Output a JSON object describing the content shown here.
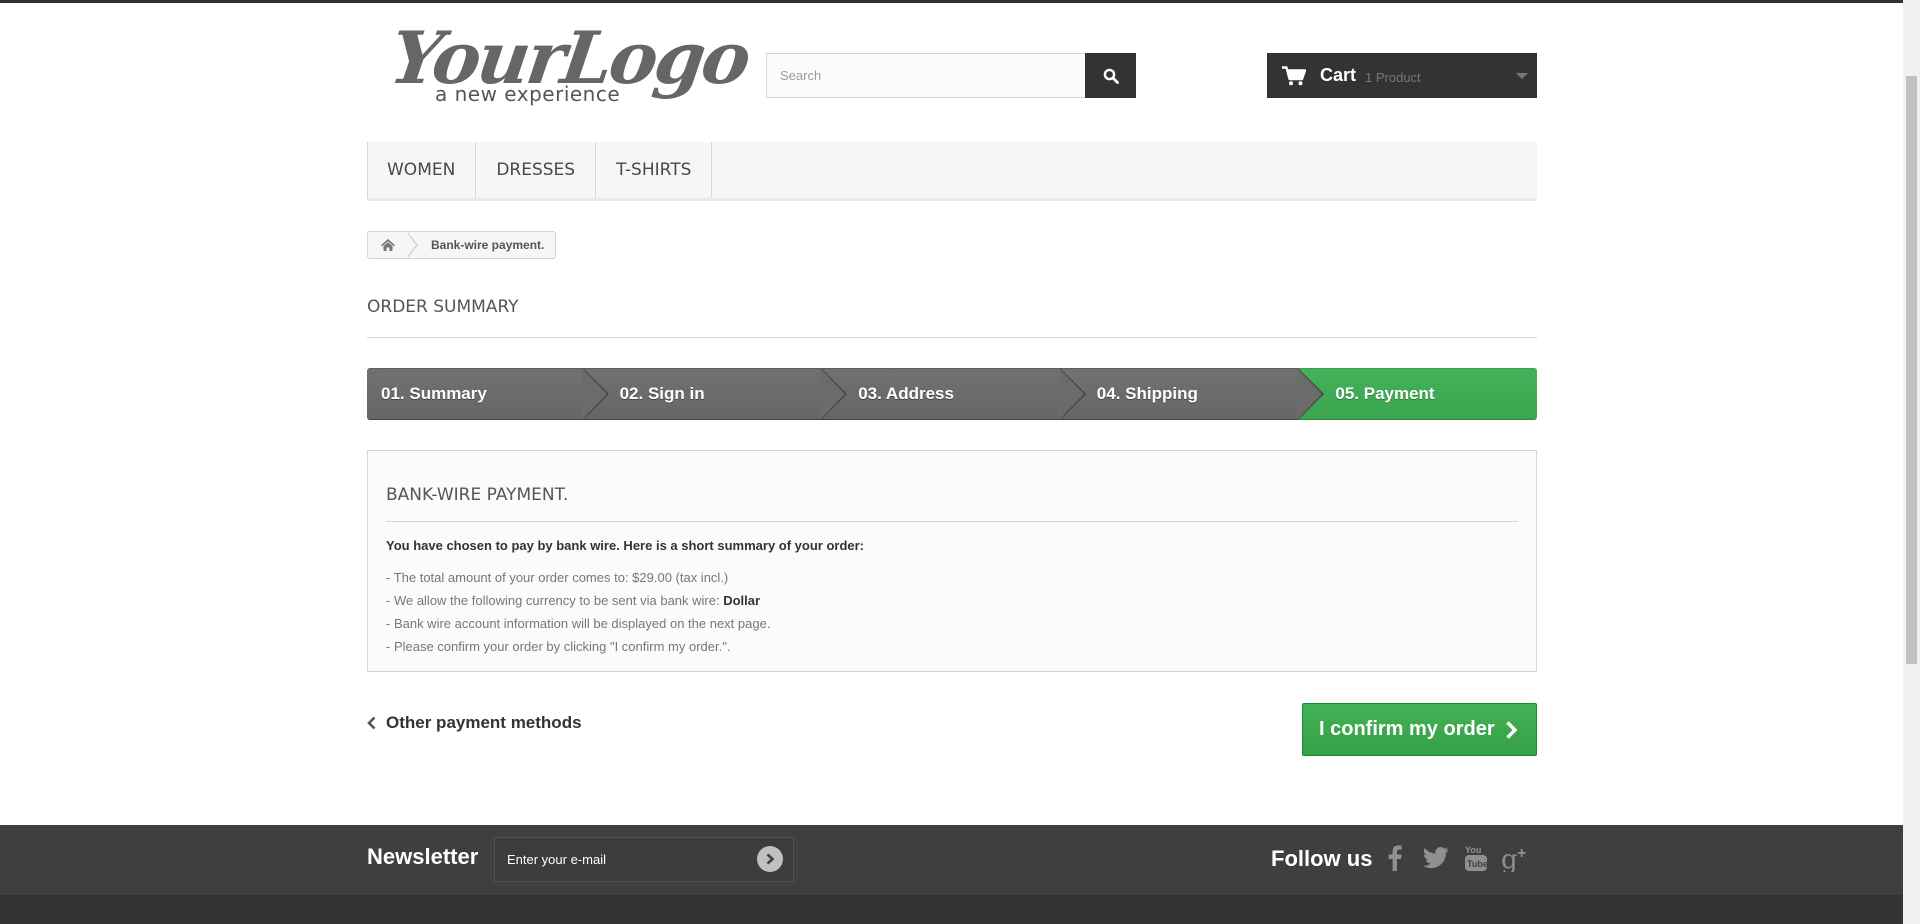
{
  "header": {
    "logo_main": "YourLogo",
    "logo_tagline": "a new experience",
    "search_placeholder": "Search",
    "cart_label": "Cart",
    "cart_quantity": "1 Product"
  },
  "menu": {
    "items": [
      "WOMEN",
      "DRESSES",
      "T-SHIRTS"
    ]
  },
  "breadcrumb": {
    "current": "Bank-wire payment."
  },
  "page": {
    "heading": "ORDER SUMMARY"
  },
  "steps": [
    "01. Summary",
    "02. Sign in",
    "03. Address",
    "04. Shipping",
    "05. Payment"
  ],
  "payment_box": {
    "title": "BANK-WIRE PAYMENT.",
    "lead": "You have chosen to pay by bank wire. Here is a short summary of your order:",
    "line1": "- The total amount of your order comes to: $29.00 (tax incl.)",
    "line2_prefix": "- We allow the following currency to be sent via bank wire: ",
    "line2_currency": "Dollar",
    "line3": "- Bank wire account information will be displayed on the next page.",
    "line4": "- Please confirm your order by clicking \"I confirm my order.\"."
  },
  "actions": {
    "back_label": "Other payment methods",
    "confirm_label": "I confirm my order"
  },
  "footer": {
    "newsletter_title": "Newsletter",
    "newsletter_placeholder": "Enter your e-mail",
    "follow_title": "Follow us",
    "social": [
      "facebook-icon",
      "twitter-icon",
      "youtube-icon",
      "google-plus-icon"
    ]
  },
  "colors": {
    "dark": "#333333",
    "accent_green": "#3aa44f",
    "footer_bg": "#3f3f3f"
  }
}
